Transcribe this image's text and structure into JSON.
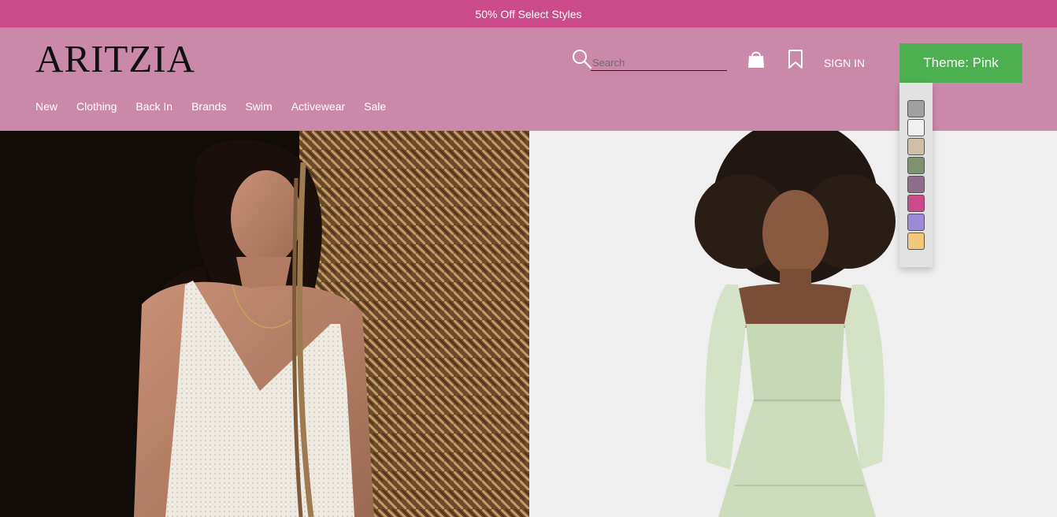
{
  "promo": {
    "text": "50% Off Select Styles"
  },
  "header": {
    "logo": "ARITZIA",
    "search_placeholder": "Search",
    "sign_in": "SIGN IN",
    "theme_button": "Theme: Pink"
  },
  "nav": {
    "items": [
      {
        "label": "New"
      },
      {
        "label": "Clothing"
      },
      {
        "label": "Back In"
      },
      {
        "label": "Brands"
      },
      {
        "label": "Swim"
      },
      {
        "label": "Activewear"
      },
      {
        "label": "Sale"
      }
    ]
  },
  "theme_swatches": [
    "#a0a0a0",
    "#f0f0f0",
    "#cfbfa8",
    "#7d9370",
    "#8e6e8a",
    "#cb4b8b",
    "#9c8ad8",
    "#f2c87c"
  ],
  "colors": {
    "promo_bg": "#cb4b8b",
    "header_bg": "#cb89aa",
    "theme_button_bg": "#4caf50"
  },
  "icons": {
    "search": "search-icon",
    "bag": "shopping-bag-icon",
    "bookmark": "bookmark-icon"
  }
}
